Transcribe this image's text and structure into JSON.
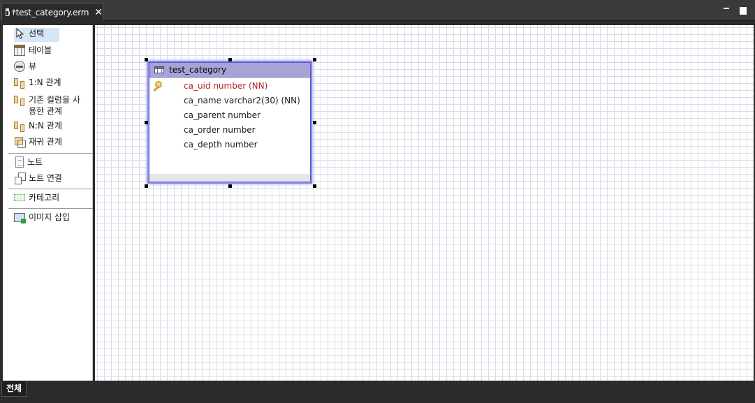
{
  "editor_tab": {
    "title": "*test_category.erm",
    "close_glyph": "✕"
  },
  "palette": {
    "items": [
      {
        "label": "선택",
        "icon": "pointer-arrow-icon"
      },
      {
        "label": "테이블",
        "icon": "table-icon"
      },
      {
        "label": "뷰",
        "icon": "view-icon"
      },
      {
        "label": "1:N 관계",
        "icon": "one-to-many-relation-icon"
      },
      {
        "label": "기존 컬럼을 사",
        "label2": "용한 관계",
        "icon": "existing-column-relation-icon"
      },
      {
        "label": "N:N 관계",
        "icon": "many-to-many-relation-icon"
      },
      {
        "label": "재귀 관계",
        "icon": "self-relation-icon"
      },
      {
        "label": "노트",
        "icon": "note-icon"
      },
      {
        "label": "노트 연결",
        "icon": "note-link-icon"
      },
      {
        "label": "카테고리",
        "icon": "category-icon"
      },
      {
        "label": "이미지 삽입",
        "icon": "insert-image-icon"
      }
    ],
    "selected": "선택"
  },
  "entity": {
    "name": "test_category",
    "columns": [
      {
        "text": "ca_uid number (NN)",
        "primary_key": true
      },
      {
        "text": "ca_name varchar2(30) (NN)",
        "primary_key": false
      },
      {
        "text": "ca_parent number",
        "primary_key": false
      },
      {
        "text": "ca_order number",
        "primary_key": false
      },
      {
        "text": "ca_depth number",
        "primary_key": false
      }
    ]
  },
  "bottom_tab": {
    "label": "전체"
  },
  "colors": {
    "entity_header": "#a7a3d6",
    "selection_glow": "#8a8aee",
    "primary_key_text": "#b2252a",
    "grid_line": "#dcdce8"
  }
}
